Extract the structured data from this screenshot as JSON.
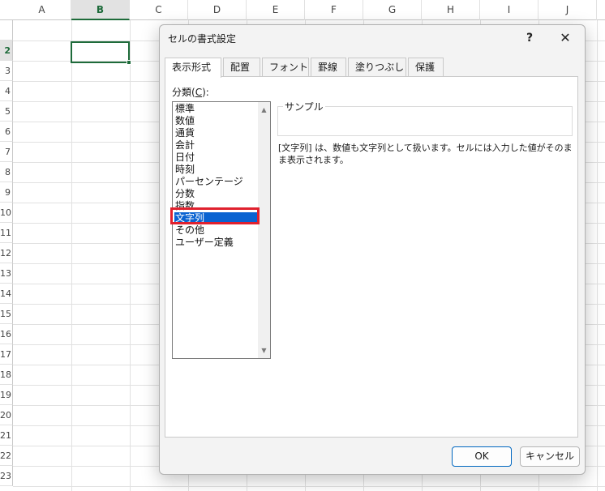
{
  "sheet": {
    "columns": [
      "A",
      "B",
      "C",
      "D",
      "E",
      "F",
      "G",
      "H",
      "I",
      "J"
    ],
    "active_column": "B",
    "rows": [
      "",
      "2",
      "3",
      "4",
      "5",
      "6",
      "7",
      "8",
      "9",
      "10",
      "11",
      "12",
      "13",
      "14",
      "15",
      "16",
      "17",
      "18",
      "19",
      "20",
      "21",
      "22",
      "23"
    ],
    "active_row": "2"
  },
  "dialog": {
    "title": "セルの書式設定",
    "help_label": "?",
    "close_label": "✕",
    "tabs": [
      {
        "label": "表示形式",
        "active": true
      },
      {
        "label": "配置"
      },
      {
        "label": "フォント"
      },
      {
        "label": "罫線"
      },
      {
        "label": "塗りつぶし"
      },
      {
        "label": "保護"
      }
    ],
    "category_label_prefix": "分類(",
    "category_label_key": "C",
    "category_label_suffix": "):",
    "categories": [
      "標準",
      "数値",
      "通貨",
      "会計",
      "日付",
      "時刻",
      "パーセンテージ",
      "分数",
      "指数",
      "文字列",
      "その他",
      "ユーザー定義"
    ],
    "selected_category": "文字列",
    "scroll_up": "▲",
    "scroll_down": "▼",
    "sample_label": "サンプル",
    "description": "[文字列] は、数値も文字列として扱います。セルには入力した値がそのまま表示されます。",
    "ok_label": "OK",
    "cancel_label": "キャンセル"
  },
  "colors": {
    "selection_green": "#1e6b3a",
    "list_selection_blue": "#0a63d1",
    "highlight_red": "#e0212e"
  }
}
